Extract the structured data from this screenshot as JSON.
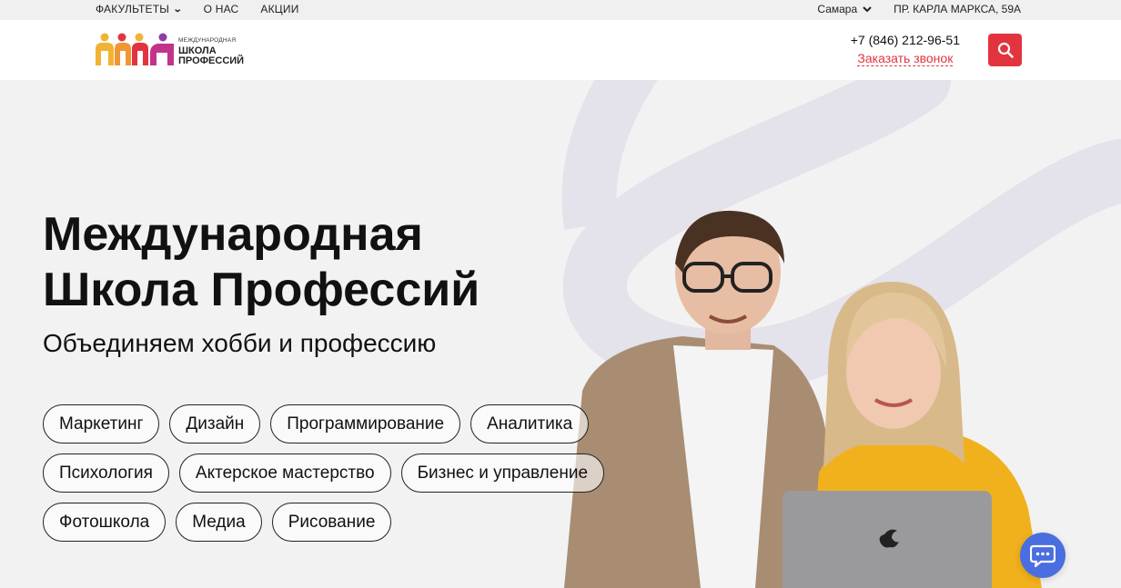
{
  "topbar": {
    "nav": [
      {
        "label": "ФАКУЛЬТЕТЫ",
        "has_dropdown": true
      },
      {
        "label": "О НАС"
      },
      {
        "label": "АКЦИИ"
      }
    ],
    "city": "Самара",
    "address": "ПР. КАРЛА МАРКСА, 59А"
  },
  "header": {
    "logo": {
      "line1": "МЕЖДУНАРОДНАЯ",
      "line2": "ШКОЛА",
      "line3": "ПРОФЕССИЙ"
    },
    "phone": "+7 (846) 212-96-51",
    "callback": "Заказать звонок",
    "search_icon": "search-icon",
    "accent_color": "#e2343f"
  },
  "hero": {
    "title_line1": "Международная",
    "title_line2": "Школа Профессий",
    "subtitle": "Объединяем хобби и профессию",
    "tags": [
      [
        "Маркетинг",
        "Дизайн",
        "Программирование",
        "Аналитика"
      ],
      [
        "Психология",
        "Актерское мастерство",
        "Бизнес и управление"
      ],
      [
        "Фотошкола",
        "Медиа",
        "Рисование"
      ]
    ]
  },
  "chat": {
    "icon": "chat-icon",
    "color": "#4a6ee0"
  }
}
